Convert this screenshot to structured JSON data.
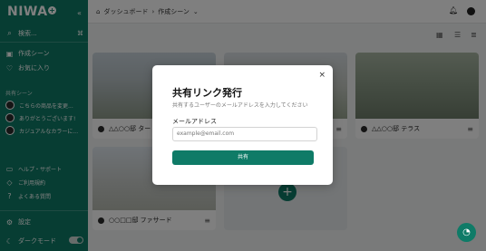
{
  "app": {
    "logo": "NIWA",
    "logo_badge": "+"
  },
  "sidebar": {
    "search": "検索...",
    "search_shortcut": "⌘",
    "items": [
      {
        "label": "作成シーン"
      },
      {
        "label": "お気に入り"
      }
    ],
    "shared_title": "共有シーン",
    "shared": [
      {
        "label": "こちらの商品を変更..."
      },
      {
        "label": "ありがとうございます!"
      },
      {
        "label": "カジュアルなカラーに..."
      }
    ],
    "help": [
      {
        "label": "ヘルプ・サポート"
      },
      {
        "label": "ご利用規約"
      },
      {
        "label": "よくある質問"
      }
    ],
    "settings": "設定",
    "dark_mode": "ダークモード"
  },
  "header": {
    "breadcrumb": [
      "ダッシュボード",
      "作成シーン"
    ]
  },
  "cards": [
    {
      "title": "△△○○邸 ター"
    },
    {
      "title": "△△○○邸 テラス"
    },
    {
      "title": "○○□□邸 ファサード"
    }
  ],
  "modal": {
    "title": "共有リンク発行",
    "subtitle": "共有するユーザーのメールアドレスを入力してください",
    "email_label": "メールアドレス",
    "email_placeholder": "example@email.com",
    "share_button": "共有"
  },
  "colors": {
    "accent": "#0f7b67"
  }
}
